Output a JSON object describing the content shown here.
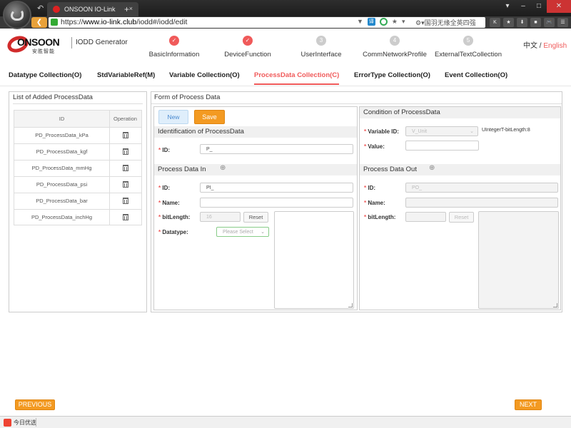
{
  "browser": {
    "tab_title": "ONSOON IO-Link",
    "url_scheme": "https://",
    "url_domain": "www.io-link.club",
    "url_path": "/iodd#/iodd/edit",
    "search_text": "国羽无缘全英四强",
    "back_icon": "arrow-left",
    "toolbar_icons": [
      "K",
      "★",
      "⬇",
      "■",
      "🎮",
      "☰"
    ]
  },
  "header": {
    "brand": "ONSOON",
    "brand_cn": "安胜智能",
    "app_title": "IODD Generator",
    "lang_cn": "中文",
    "lang_sep": " / ",
    "lang_en": "English",
    "steps": [
      {
        "label": "BasicInformation",
        "mark": "✓",
        "done": true
      },
      {
        "label": "DeviceFunction",
        "mark": "✓",
        "done": true
      },
      {
        "label": "UserInterface",
        "mark": "3",
        "done": false
      },
      {
        "label": "CommNetworkProfile",
        "mark": "4",
        "done": false
      },
      {
        "label": "ExternalTextCollection",
        "mark": "5",
        "done": false
      }
    ]
  },
  "subtabs": [
    "Datatype Collection(O)",
    "StdVariableRef(M)",
    "Variable Collection(O)",
    "ProcessData Collection(C)",
    "ErrorType Collection(O)",
    "Event Collection(O)"
  ],
  "active_subtab": "ProcessData Collection(C)",
  "left_panel": {
    "title": "List of Added ProcessData",
    "col_id": "ID",
    "col_op": "Operation",
    "rows": [
      "PD_ProcessData_kPa",
      "PD_ProcessData_kgf",
      "PD_ProcessData_mmHg",
      "PD_ProcessData_psi",
      "PD_ProcessData_bar",
      "PD_ProcessData_inchHg"
    ]
  },
  "form": {
    "title": "Form of Process Data",
    "new_label": "New",
    "save_label": "Save",
    "identification_title": "Identification of ProcessData",
    "id_label": "ID:",
    "id_value": "P_",
    "process_in_title": "Process Data In",
    "in_id_value": "PI_",
    "name_label": "Name:",
    "bitlength_label": "bitLength:",
    "in_bitlength": "16",
    "reset_label": "Reset",
    "datatype_label": "Datatype:",
    "datatype_placeholder": "Please Select"
  },
  "condition": {
    "title": "Condition of ProcessData",
    "variable_id_label": "Variable ID:",
    "variable_id_value": "V_Unit",
    "variable_type": "UIntegerT-bitLength:8",
    "value_label": "Value:"
  },
  "process_out": {
    "title": "Process Data Out",
    "id_value": "PO_"
  },
  "footer": {
    "previous_label": "PREVIOUS",
    "next_label": "NEXT"
  },
  "statusbar": {
    "text": "今日优选"
  },
  "colors": {
    "accent": "#f05a5a",
    "orange": "#f39a22",
    "chrome_dark": "#2a2a2a"
  }
}
